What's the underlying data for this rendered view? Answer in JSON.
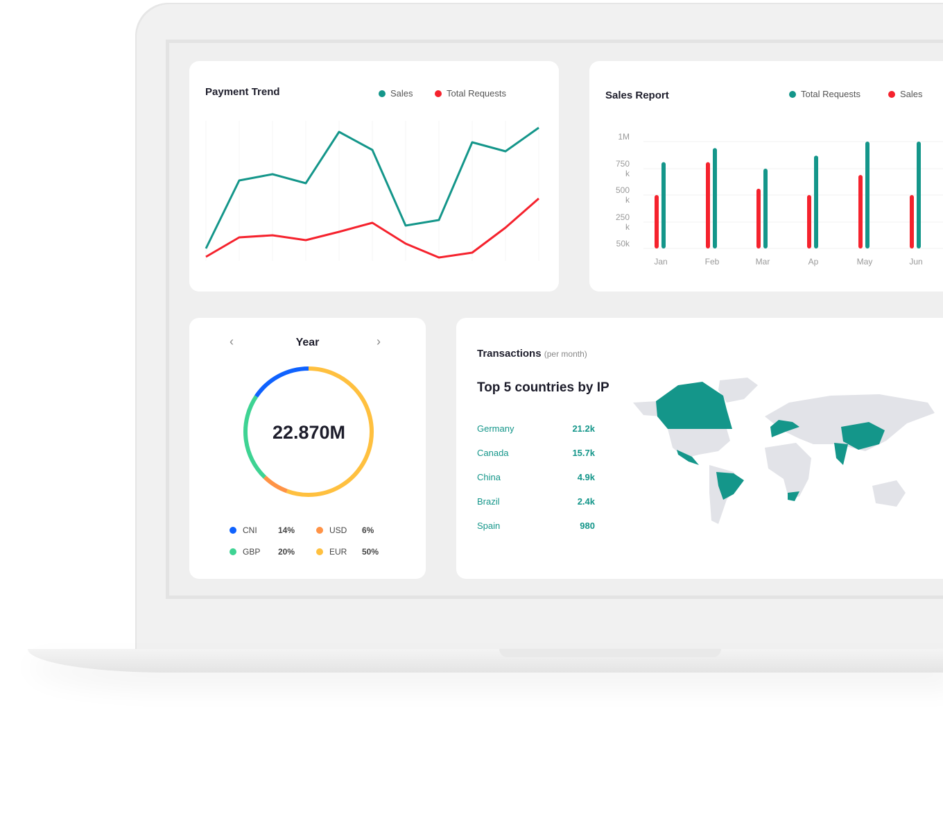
{
  "payment_trend": {
    "title": "Payment Trend",
    "legend": [
      {
        "label": "Sales",
        "color": "#14968a"
      },
      {
        "label": "Total Requests",
        "color": "#f5222d"
      }
    ],
    "chart_data": {
      "type": "line",
      "series": [
        {
          "name": "Sales",
          "color": "#14968a",
          "values": [
            22,
            120,
            129,
            116,
            190,
            164,
            55,
            63,
            175,
            162,
            196
          ]
        },
        {
          "name": "Total Requests",
          "color": "#f5222d",
          "values": [
            10,
            38,
            41,
            34,
            46,
            59,
            29,
            9,
            16,
            52,
            94
          ]
        }
      ],
      "grid": "vertical"
    }
  },
  "sales_report": {
    "title": "Sales Report",
    "legend": [
      {
        "label": "Total Requests",
        "color": "#14968a"
      },
      {
        "label": "Sales",
        "color": "#f5222d"
      }
    ],
    "chart_data": {
      "type": "bar",
      "categories": [
        "Jan",
        "Feb",
        "Mar",
        "Ap",
        "May",
        "Jun"
      ],
      "y_ticks": [
        {
          "l1": "1M",
          "l2": ""
        },
        {
          "l1": "750",
          "l2": "k"
        },
        {
          "l1": "500",
          "l2": "k"
        },
        {
          "l1": "250",
          "l2": "k"
        },
        {
          "l1": "50k",
          "l2": ""
        }
      ],
      "series": [
        {
          "name": "Sales",
          "color": "#f5222d",
          "values": [
            500,
            810,
            560,
            500,
            690,
            500
          ]
        },
        {
          "name": "Total Requests",
          "color": "#14968a",
          "values": [
            810,
            940,
            750,
            870,
            1000,
            1000
          ]
        }
      ],
      "ylim": [
        50,
        1000
      ],
      "unit": "k"
    }
  },
  "year_card": {
    "title": "Year",
    "prev_icon": "chevron-left",
    "next_icon": "chevron-right",
    "total": "22.870M",
    "chart_data": {
      "type": "pie",
      "slices": [
        {
          "label": "EUR",
          "value": 50,
          "display": "50%",
          "color": "#ffc03f"
        },
        {
          "label": "USD",
          "value": 6,
          "display": "6%",
          "color": "#ff9346"
        },
        {
          "label": "GBP",
          "value": 20,
          "display": "20%",
          "color": "#3ed393"
        },
        {
          "label": "CNI",
          "value": 14,
          "display": "14%",
          "color": "#0f62fe"
        }
      ]
    }
  },
  "transactions": {
    "title": "Transactions",
    "subtitle": "(per month)",
    "heading": "Top 5 countries by IP",
    "rows": [
      {
        "country": "Germany",
        "value": "21.2k"
      },
      {
        "country": "Canada",
        "value": "15.7k"
      },
      {
        "country": "China",
        "value": "4.9k"
      },
      {
        "country": "Brazil",
        "value": "2.4k"
      },
      {
        "country": "Spain",
        "value": "980"
      }
    ],
    "map_highlight_color": "#14968a",
    "map_base_color": "#e2e3e8"
  }
}
